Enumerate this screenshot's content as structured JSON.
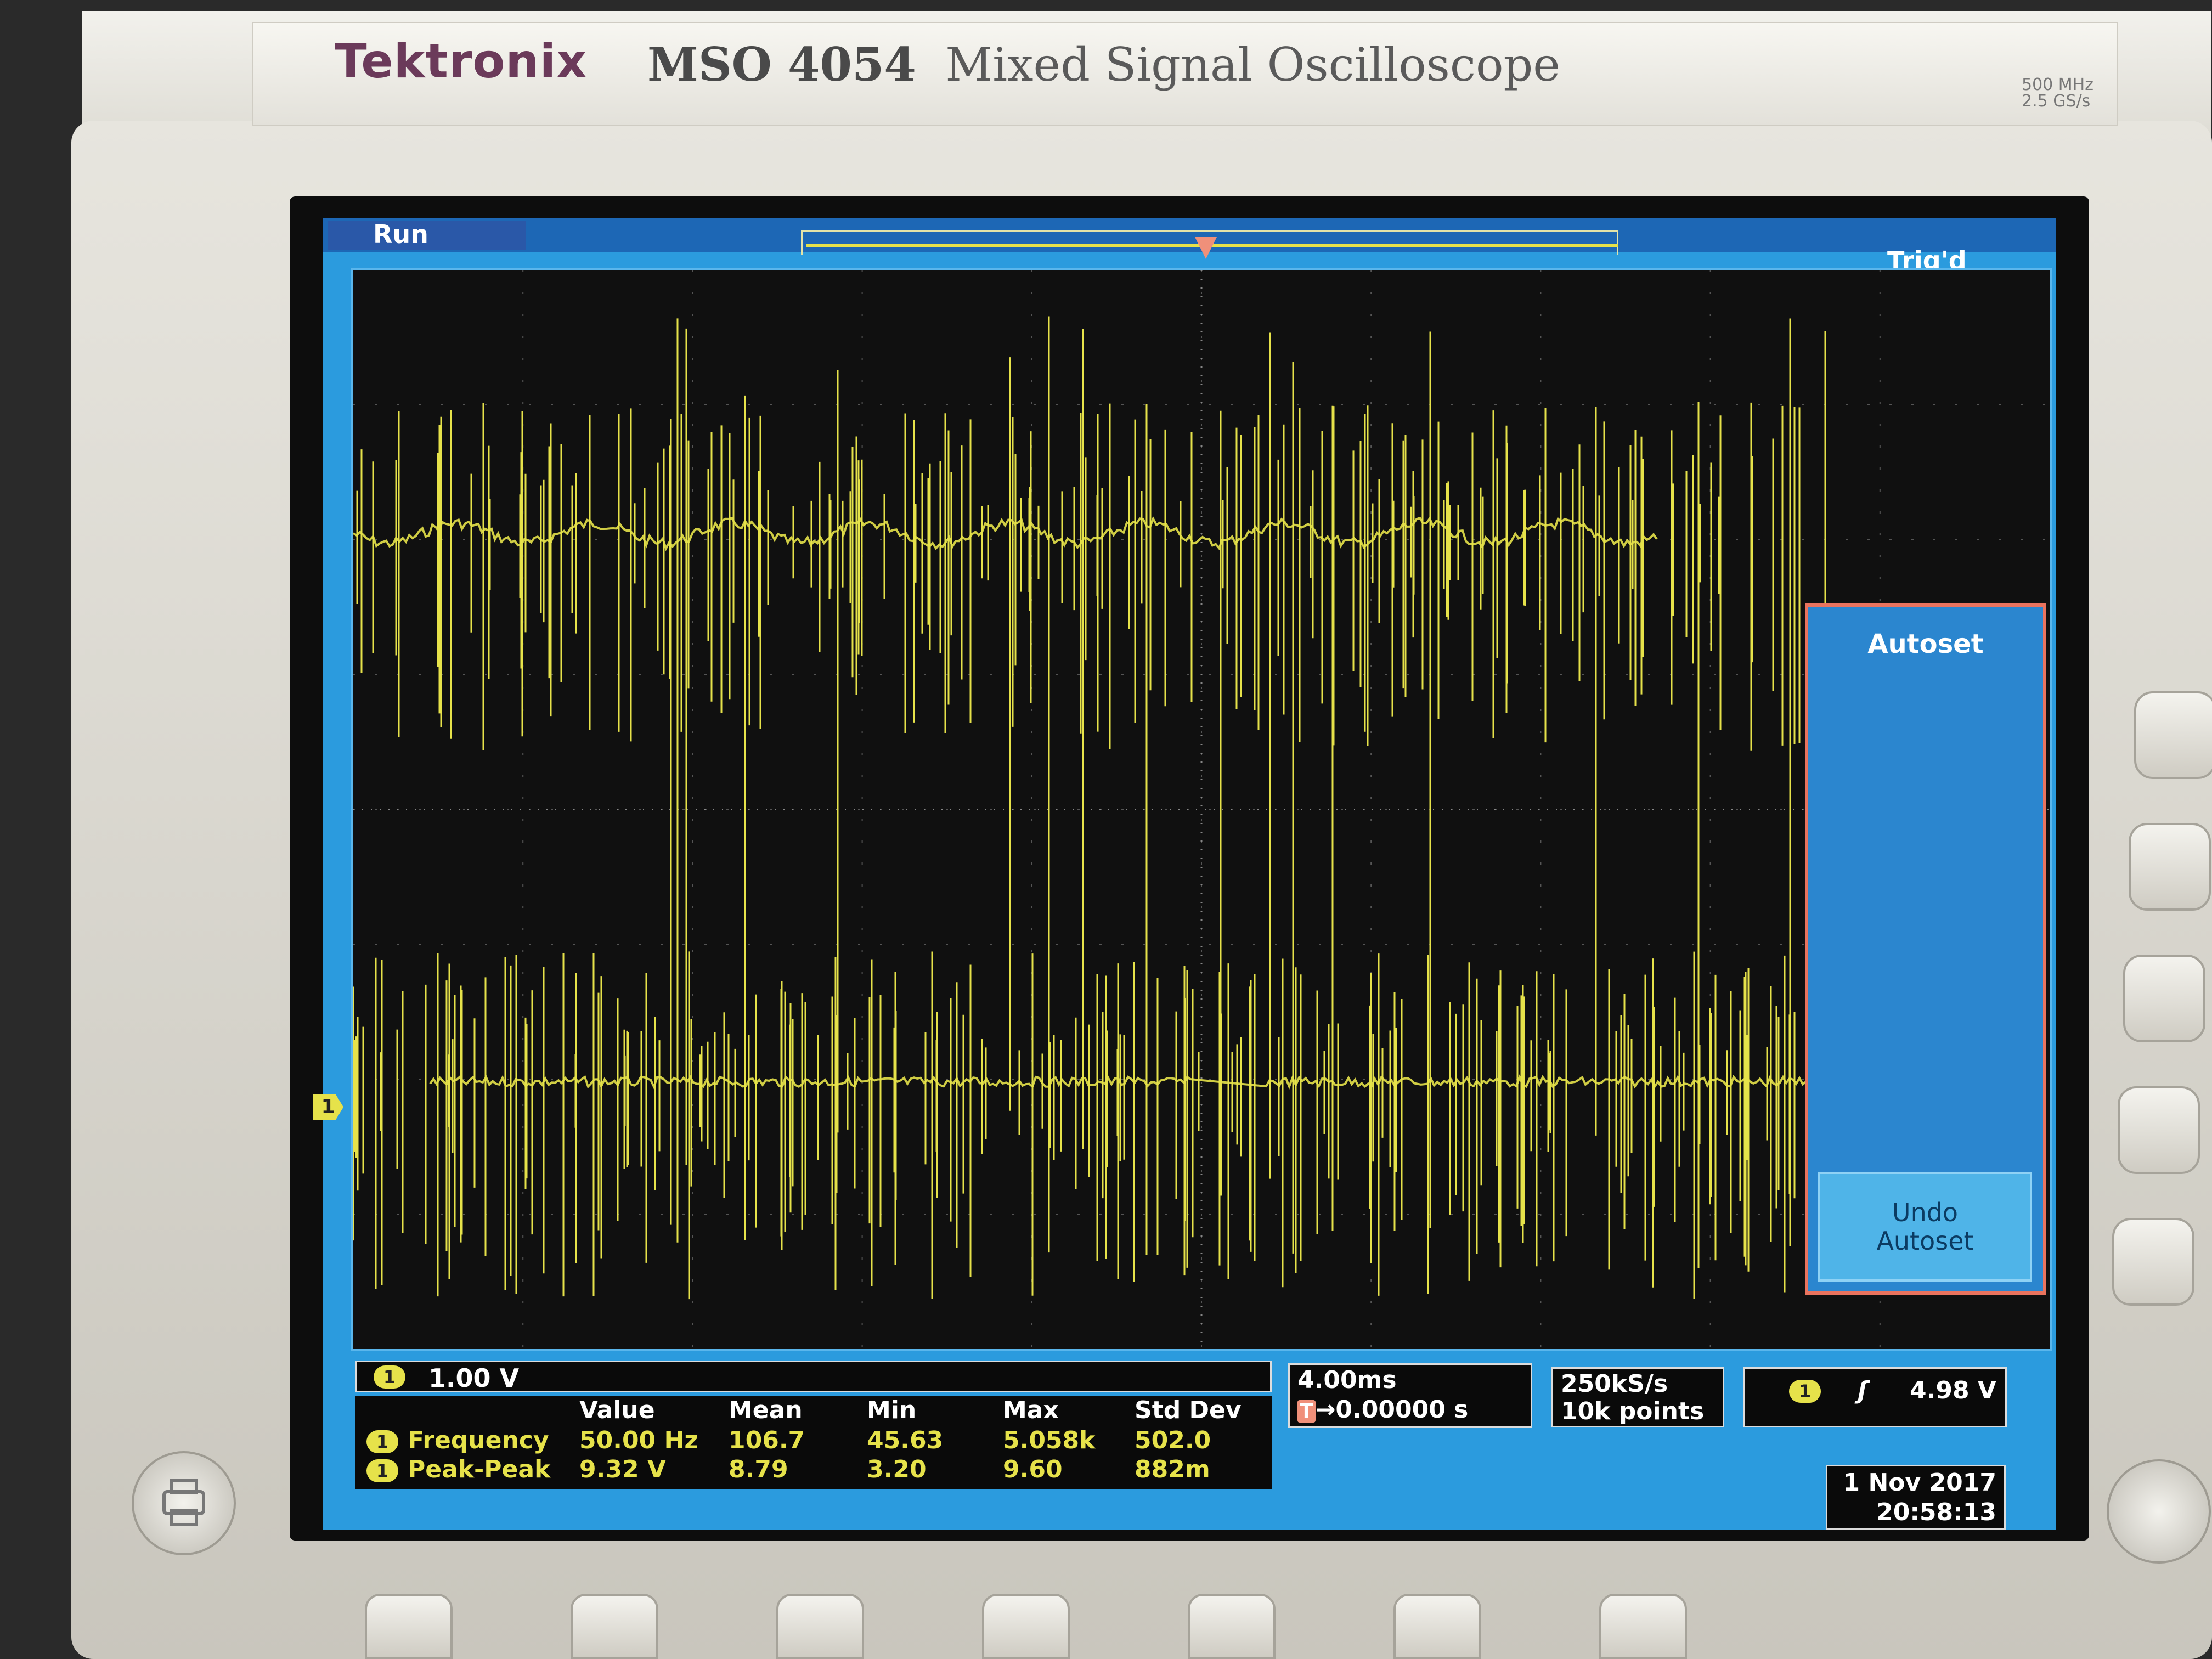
{
  "bezel": {
    "brand": "Tektronix",
    "model": "MSO 4054",
    "description": "Mixed Signal Oscilloscope",
    "spec_bandwidth": "500 MHz",
    "spec_sample_rate": "2.5 GS/s"
  },
  "screen": {
    "acq_state": "Run",
    "trigger_state": "Trig'd",
    "channel_marker": "1",
    "trigger_marker": "T",
    "side_menu": {
      "title": "Autoset",
      "undo_line1": "Undo",
      "undo_line2": "Autoset"
    },
    "channel_scale": {
      "channel": "1",
      "value": "1.00 V"
    },
    "measurements": {
      "headers": [
        "Value",
        "Mean",
        "Min",
        "Max",
        "Std Dev"
      ],
      "rows": [
        {
          "channel": "1",
          "name": "Frequency",
          "value": "50.00 Hz",
          "mean": "106.7",
          "min": "45.63",
          "max": "5.058k",
          "std": "502.0"
        },
        {
          "channel": "1",
          "name": "Peak-Peak",
          "value": "9.32 V",
          "mean": "8.79",
          "min": "3.20",
          "max": "9.60",
          "std": "882m"
        }
      ]
    },
    "timebase": {
      "scale": "4.00ms",
      "delay": "→0.00000 s",
      "delay_prefix": "T"
    },
    "acquisition": {
      "rate": "250kS/s",
      "points": "10k points"
    },
    "trigger": {
      "channel": "1",
      "slope": "ʃ",
      "level": "4.98 V"
    },
    "datetime": {
      "date": "1 Nov 2017",
      "time": "20:58:13"
    }
  },
  "colors": {
    "trace": "#e6e24a",
    "screen_bg": "#2b9bde",
    "menu_border": "#e9735e"
  }
}
